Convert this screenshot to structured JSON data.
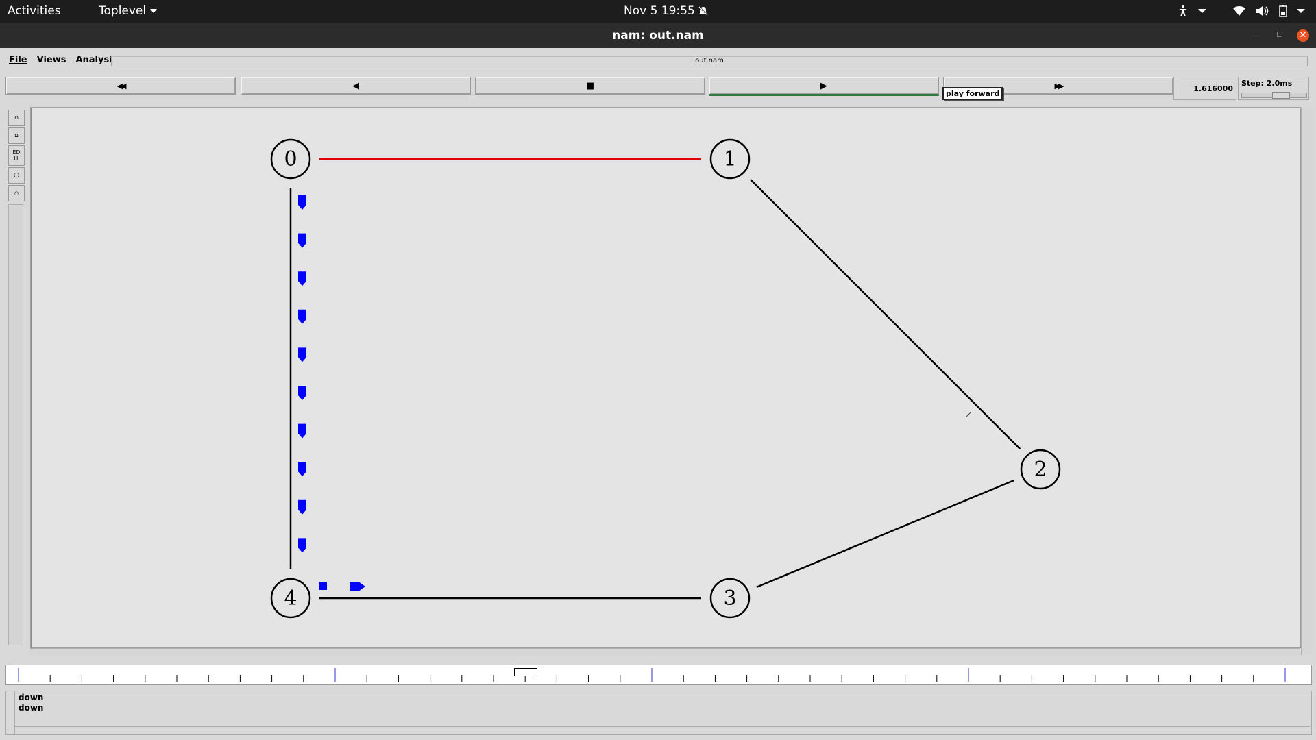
{
  "topbar": {
    "activities": "Activities",
    "toplevel": "Toplevel",
    "clock": "Nov 5  19:55"
  },
  "window": {
    "title": "nam: out.nam"
  },
  "menu": {
    "file": "File",
    "views": "Views",
    "analysis": "Analysis"
  },
  "filename": "out.nam",
  "controls": {
    "rewind": "◀◀",
    "back": "◀",
    "stop": "■",
    "play": "▶",
    "fastforward": "▶▶",
    "tooltip": "play forward"
  },
  "time_value": "1.616000",
  "step_label": "Step: 2.0ms",
  "step_slider_fraction": 0.6,
  "timeline_position_fraction": 0.4,
  "nodes": [
    {
      "id": "0"
    },
    {
      "id": "1"
    },
    {
      "id": "2"
    },
    {
      "id": "3"
    },
    {
      "id": "4"
    }
  ],
  "links": [
    {
      "from": "0",
      "to": "1",
      "color": "#e00000"
    },
    {
      "from": "1",
      "to": "2",
      "color": "#000000"
    },
    {
      "from": "2",
      "to": "3",
      "color": "#000000"
    },
    {
      "from": "3",
      "to": "4",
      "color": "#000000"
    },
    {
      "from": "4",
      "to": "0",
      "color": "#000000"
    }
  ],
  "packet_color": "#0000ff",
  "log_lines": [
    "down",
    "down"
  ]
}
